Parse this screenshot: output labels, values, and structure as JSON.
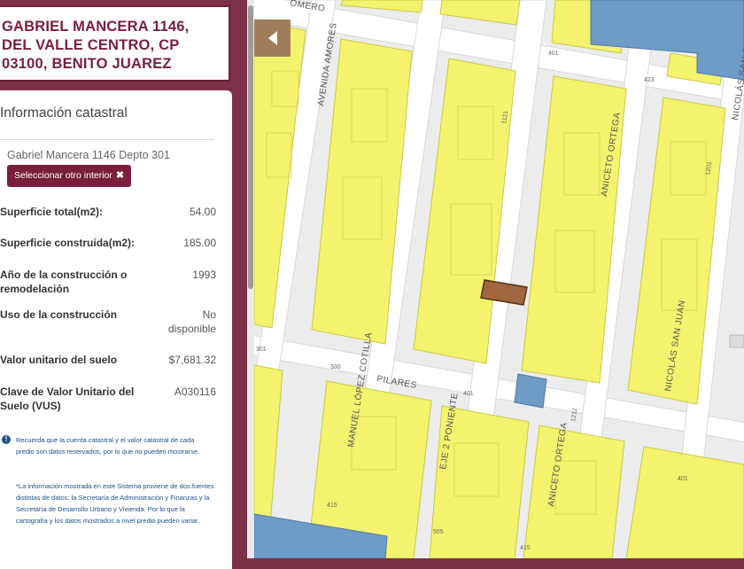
{
  "header": {
    "address": "GABRIEL MANCERA 1146,\nDEL VALLE CENTRO, CP\n03100, BENITO JUAREZ"
  },
  "info": {
    "title": "Información catastral",
    "interior_name": "Gabriel Mancera 1146 Depto 301",
    "select_button_label": "Seleccionar otro interior",
    "rows": [
      {
        "label": "Superficie total(m2):",
        "value": "54.00"
      },
      {
        "label": "Superficie construida(m2):",
        "value": "185.00"
      },
      {
        "label": "Año de la construcción o remodelación",
        "value": "1993"
      },
      {
        "label": "Uso de la construcción",
        "value": "No disponible"
      },
      {
        "label": "Valor unitario del suelo",
        "value": "$7,681.32"
      },
      {
        "label": "Clave de Valor Unitario del Suelo (VUS)",
        "value": "A030116"
      }
    ],
    "notice_1": "Recuerda que la cuenta catastral y el valor catastral de cada predio son datos reservados, por lo que no pueden mostrarse.",
    "notice_2": "*La información mostrada en este Sistema proviene de dos fuentes distintas de datos: la Secretaría de Administración y Finanzas y la Secretaría de Desarrollo Urbano y Vivienda. Por lo que la cartografía y los datos mostrados a nivel predio pueden variar."
  },
  "map": {
    "streets": {
      "avenida_amores": "AVENIDA AMORES",
      "avenida_left": "AVENIDA",
      "manuel_lopez_cotilla": "MANUEL LÓPEZ COTILLA",
      "eje_2_poniente": "EJE 2 PONIENTE",
      "aniceto_ortega_top": "ANICETO ORTEGA",
      "aniceto_ortega_bottom": "ANICETO ORTEGA",
      "nicolas_san_juan_top": "NICOLÁS SAN J",
      "nicolas_san_juan_bottom": "NICOLÁS SAN JUAN",
      "pilares": "PILARES",
      "romero": "OMERO"
    },
    "numbers": [
      "401",
      "423",
      "1121",
      "1201",
      "301",
      "330",
      "401",
      "415",
      "505",
      "401",
      "415",
      "1212"
    ],
    "colors": {
      "lot": "#f3f36e",
      "lot_stroke": "#c9c94a",
      "public": "#6f9bc7",
      "selected": "#a0663f",
      "street": "#ffffff",
      "background": "#ececec"
    },
    "toggle_icon": "chevron-left-icon"
  }
}
